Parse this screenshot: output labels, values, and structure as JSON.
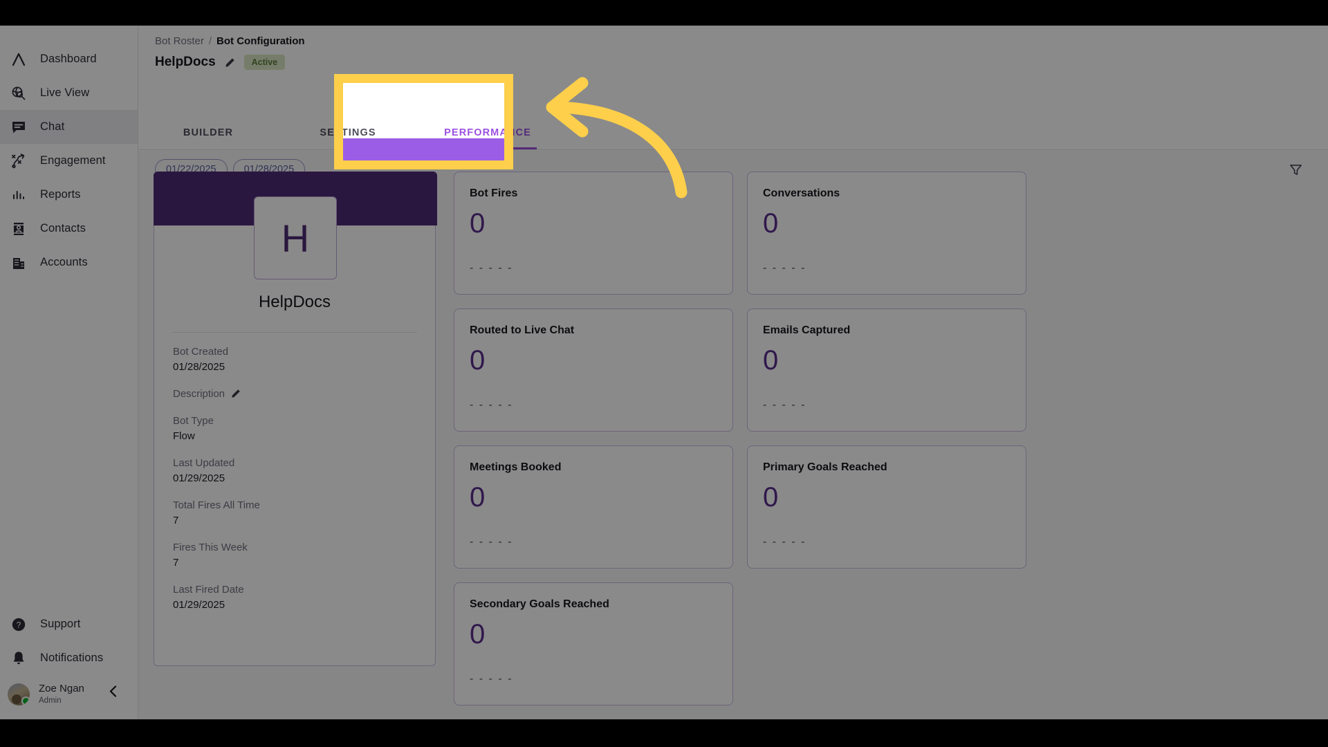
{
  "sidebar": {
    "top_items": [
      {
        "label": "Dashboard",
        "icon": "logo-chevron-icon",
        "active": false
      },
      {
        "label": "Live View",
        "icon": "globe-search-icon",
        "active": false
      },
      {
        "label": "Chat",
        "icon": "chat-bubble-icon",
        "active": true
      },
      {
        "label": "Engagement",
        "icon": "engagement-path-icon",
        "active": false
      },
      {
        "label": "Reports",
        "icon": "bar-chart-icon",
        "active": false
      },
      {
        "label": "Contacts",
        "icon": "contact-card-icon",
        "active": false
      },
      {
        "label": "Accounts",
        "icon": "building-icon",
        "active": false
      }
    ],
    "bottom_items": [
      {
        "label": "Support",
        "icon": "help-circle-icon"
      },
      {
        "label": "Notifications",
        "icon": "bell-icon"
      }
    ],
    "user": {
      "name": "Zoe Ngan",
      "role": "Admin",
      "presence": "online"
    },
    "collapse_label": "‹"
  },
  "breadcrumb": {
    "parent": "Bot Roster",
    "separator": "/",
    "current": "Bot Configuration"
  },
  "header": {
    "bot_name": "HelpDocs",
    "status": "Active"
  },
  "tabs": [
    {
      "label": "BUILDER",
      "active": false
    },
    {
      "label": "SETTINGS",
      "active": false
    },
    {
      "label": "PERFORMANCE",
      "active": true
    }
  ],
  "toolbar": {
    "date_start": "01/22/2025",
    "date_end": "01/28/2025",
    "filter_icon": "funnel-icon"
  },
  "bot_card": {
    "avatar_letter": "H",
    "name": "HelpDocs",
    "fields": [
      {
        "label": "Bot Created",
        "value": "01/28/2025",
        "editable": false
      },
      {
        "label": "Description",
        "value": "",
        "editable": true
      },
      {
        "label": "Bot Type",
        "value": "Flow",
        "editable": false
      },
      {
        "label": "Last Updated",
        "value": "01/29/2025",
        "editable": false
      },
      {
        "label": "Total Fires All Time",
        "value": "7",
        "editable": false
      },
      {
        "label": "Fires This Week",
        "value": "7",
        "editable": false
      },
      {
        "label": "Last Fired Date",
        "value": "01/29/2025",
        "editable": false
      }
    ]
  },
  "metrics": [
    {
      "title": "Bot Fires",
      "value": "0",
      "sub": "- - - - -"
    },
    {
      "title": "Conversations",
      "value": "0",
      "sub": "- - - - -"
    },
    {
      "title": "Routed to Live Chat",
      "value": "0",
      "sub": "- - - - -"
    },
    {
      "title": "Emails Captured",
      "value": "0",
      "sub": "- - - - -"
    },
    {
      "title": "Meetings Booked",
      "value": "0",
      "sub": "- - - - -"
    },
    {
      "title": "Primary Goals Reached",
      "value": "0",
      "sub": "- - - - -"
    },
    {
      "title": "Secondary Goals Reached",
      "value": "0",
      "sub": "- - - - -"
    }
  ],
  "annotation": {
    "highlight_target": "PERFORMANCE",
    "highlight_color": "#fdcf4b",
    "arrow": "curved-left-arrow"
  },
  "colors": {
    "accent_purple": "#9b51e0",
    "deep_purple": "#4f2c75",
    "value_purple": "#5a2d8c",
    "banner_light_purple": "#9b5de5",
    "badge_green_bg": "#d9e8c4",
    "badge_green_text": "#5e7a3c",
    "highlight_yellow": "#fdcf4b"
  }
}
